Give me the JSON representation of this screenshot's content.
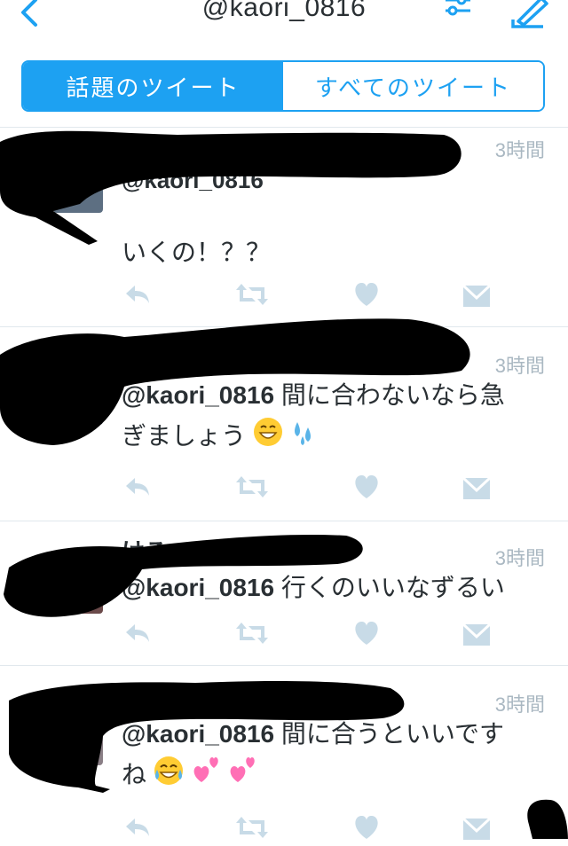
{
  "header": {
    "title": "@kaori_0816"
  },
  "segmented": {
    "tabs": [
      {
        "label": "話題のツイート",
        "active": true
      },
      {
        "label": "すべてのツイート",
        "active": false
      }
    ]
  },
  "tweets": [
    {
      "time": "3時間",
      "name_visible": "",
      "handle_line": "@kaori_0816",
      "body": "いくの！？？",
      "emojis": []
    },
    {
      "time": "3時間",
      "mention": "@kaori_0816",
      "body_line1": " 間に合わないなら急",
      "body_line2": "ぎましょう",
      "emojis": [
        "grin",
        "sweat-drops"
      ]
    },
    {
      "time": "3時間",
      "name_partial": "けろ",
      "mention": "@kaori_0816",
      "body_line1": " 行くのいいなずるい"
    },
    {
      "time": "3時間",
      "mention": "@kaori_0816",
      "body_line1": " 間に合うといいです",
      "body_line2": "ね",
      "emojis": [
        "joy",
        "two-hearts",
        "two-hearts"
      ]
    }
  ],
  "colors": {
    "accent": "#1da1f2",
    "muted_icon": "#c8dbe7",
    "time": "#aab8c2"
  },
  "icons": [
    "back-chevron-icon",
    "filter-sliders-icon",
    "compose-icon",
    "reply-icon",
    "retweet-icon",
    "like-icon",
    "dm-icon"
  ]
}
